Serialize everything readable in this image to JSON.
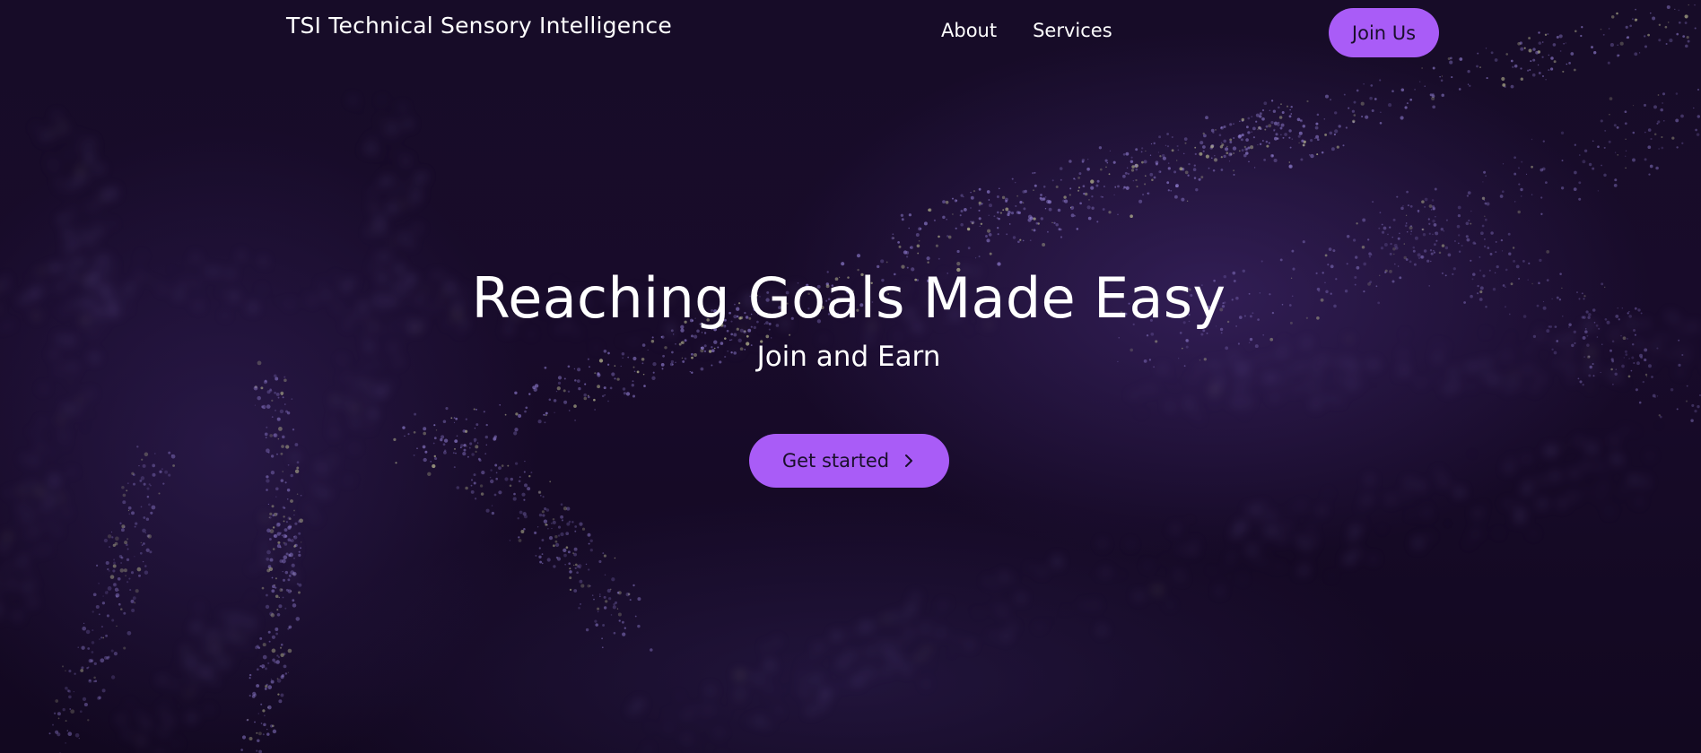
{
  "header": {
    "site_title": "TSI Technical Sensory Intelligence",
    "nav": [
      {
        "label": "About"
      },
      {
        "label": "Services"
      }
    ],
    "join_label": "Join Us"
  },
  "hero": {
    "headline": "Reaching Goals Made Easy",
    "subheadline": "Join and Earn",
    "cta_label": "Get started",
    "cta_icon": "chevron-right-icon"
  },
  "colors": {
    "background": "#150b25",
    "accent": "#a95cf7",
    "button_text": "#1a0f2b",
    "text": "#ffffff",
    "particle": "#8a78c8",
    "particle_highlight": "#b8b890"
  }
}
